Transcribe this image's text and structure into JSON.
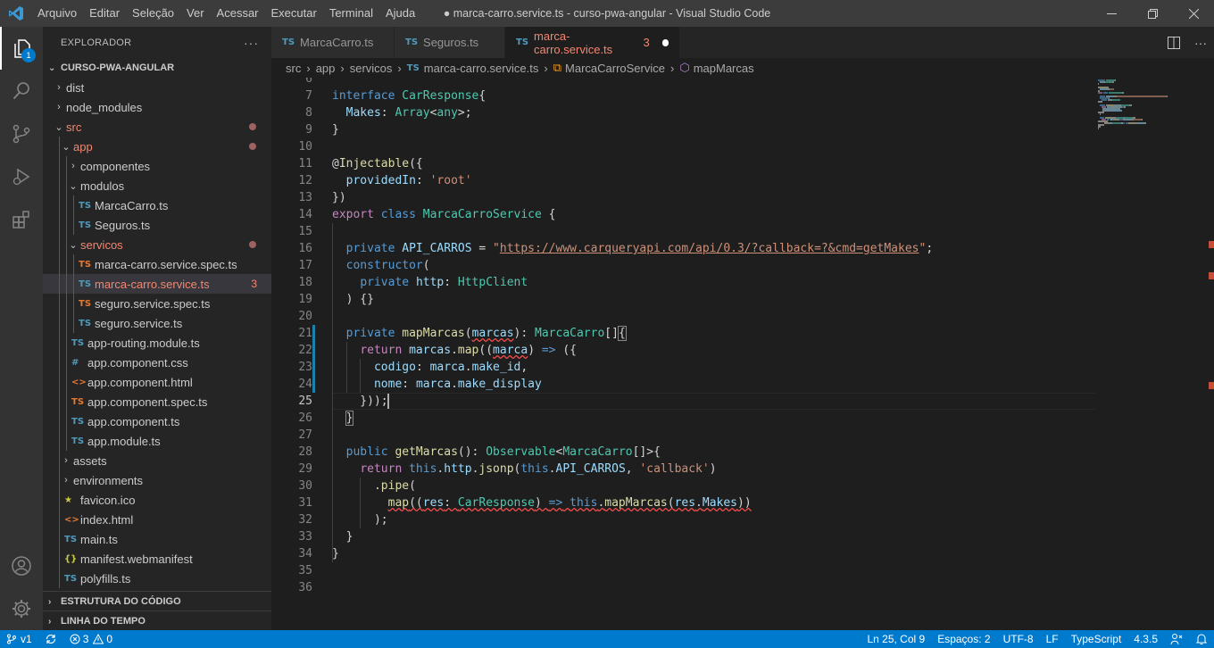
{
  "window": {
    "title": "● marca-carro.service.ts - curso-pwa-angular - Visual Studio Code",
    "menu": [
      "Arquivo",
      "Editar",
      "Seleção",
      "Ver",
      "Acessar",
      "Executar",
      "Terminal",
      "Ajuda"
    ]
  },
  "activity_bar": {
    "explorer_badge": "1",
    "items": [
      "explorer-icon",
      "search-icon",
      "source-control-icon",
      "run-debug-icon",
      "extensions-icon",
      "account-icon",
      "gear-icon"
    ]
  },
  "sidebar": {
    "header": "EXPLORADOR",
    "more": "···",
    "project": "CURSO-PWA-ANGULAR",
    "tree": [
      {
        "label": "dist",
        "type": "folder",
        "open": false,
        "depth": 1
      },
      {
        "label": "node_modules",
        "type": "folder",
        "open": false,
        "depth": 1
      },
      {
        "label": "src",
        "type": "folder",
        "open": true,
        "depth": 1,
        "modified": true
      },
      {
        "label": "app",
        "type": "folder",
        "open": true,
        "depth": 2,
        "modified": true
      },
      {
        "label": "componentes",
        "type": "folder",
        "open": false,
        "depth": 3
      },
      {
        "label": "modulos",
        "type": "folder",
        "open": true,
        "depth": 3
      },
      {
        "label": "MarcaCarro.ts",
        "type": "ts",
        "depth": 4
      },
      {
        "label": "Seguros.ts",
        "type": "ts",
        "depth": 4
      },
      {
        "label": "servicos",
        "type": "folder",
        "open": true,
        "depth": 3,
        "modified": true
      },
      {
        "label": "marca-carro.service.spec.ts",
        "type": "ts-spec",
        "depth": 4
      },
      {
        "label": "marca-carro.service.ts",
        "type": "ts",
        "depth": 4,
        "selected": true,
        "errors": "3"
      },
      {
        "label": "seguro.service.spec.ts",
        "type": "ts-spec",
        "depth": 4
      },
      {
        "label": "seguro.service.ts",
        "type": "ts",
        "depth": 4
      },
      {
        "label": "app-routing.module.ts",
        "type": "ts",
        "depth": 3
      },
      {
        "label": "app.component.css",
        "type": "css",
        "depth": 3
      },
      {
        "label": "app.component.html",
        "type": "html",
        "depth": 3
      },
      {
        "label": "app.component.spec.ts",
        "type": "ts-spec",
        "depth": 3
      },
      {
        "label": "app.component.ts",
        "type": "ts",
        "depth": 3
      },
      {
        "label": "app.module.ts",
        "type": "ts",
        "depth": 3
      },
      {
        "label": "assets",
        "type": "folder",
        "open": false,
        "depth": 2
      },
      {
        "label": "environments",
        "type": "folder",
        "open": false,
        "depth": 2
      },
      {
        "label": "favicon.ico",
        "type": "ico",
        "depth": 2
      },
      {
        "label": "index.html",
        "type": "html",
        "depth": 2
      },
      {
        "label": "main.ts",
        "type": "ts",
        "depth": 2
      },
      {
        "label": "manifest.webmanifest",
        "type": "json",
        "depth": 2
      },
      {
        "label": "polyfills.ts",
        "type": "ts",
        "depth": 2
      }
    ],
    "outline_label": "ESTRUTURA DO CÓDIGO",
    "timeline_label": "LINHA DO TEMPO"
  },
  "tabs": [
    {
      "label": "MarcaCarro.ts",
      "active": false
    },
    {
      "label": "Seguros.ts",
      "active": false
    },
    {
      "label": "marca-carro.service.ts",
      "active": true,
      "problems": "3",
      "dirty": true
    }
  ],
  "breadcrumb": [
    "src",
    "app",
    "servicos",
    "marca-carro.service.ts",
    "MarcaCarroService",
    "mapMarcas"
  ],
  "editor": {
    "cursor_line": 25,
    "line_numbers": [
      "6",
      "7",
      "8",
      "9",
      "10",
      "11",
      "12",
      "13",
      "14",
      "15",
      "16",
      "17",
      "18",
      "19",
      "20",
      "21",
      "22",
      "23",
      "24",
      "25",
      "26",
      "27",
      "28",
      "29",
      "30",
      "31",
      "32",
      "33",
      "34",
      "35",
      "36"
    ],
    "lines": [
      [],
      [
        [
          "k",
          "interface"
        ],
        [
          "p",
          " "
        ],
        [
          "t",
          "CarResponse"
        ],
        [
          "p",
          "{"
        ]
      ],
      [
        [
          "p",
          "  "
        ],
        [
          "v",
          "Makes"
        ],
        [
          "p",
          ": "
        ],
        [
          "t",
          "Array"
        ],
        [
          "p",
          "<"
        ],
        [
          "t",
          "any"
        ],
        [
          "p",
          ">;"
        ]
      ],
      [
        [
          "p",
          "}"
        ]
      ],
      [],
      [
        [
          "p",
          "@"
        ],
        [
          "f",
          "Injectable"
        ],
        [
          "p",
          "({"
        ]
      ],
      [
        [
          "p",
          "  "
        ],
        [
          "v",
          "providedIn"
        ],
        [
          "p",
          ": "
        ],
        [
          "s",
          "'root'"
        ]
      ],
      [
        [
          "p",
          "})"
        ]
      ],
      [
        [
          "kc",
          "export"
        ],
        [
          "p",
          " "
        ],
        [
          "k",
          "class"
        ],
        [
          "p",
          " "
        ],
        [
          "t",
          "MarcaCarroService"
        ],
        [
          "p",
          " {"
        ]
      ],
      [],
      [
        [
          "p",
          "  "
        ],
        [
          "k",
          "private"
        ],
        [
          "p",
          " "
        ],
        [
          "v",
          "API_CARROS"
        ],
        [
          "p",
          " = "
        ],
        [
          "s",
          "\""
        ],
        [
          "su",
          "https://www.carqueryapi.com/api/0.3/?callback=?&cmd=getMakes"
        ],
        [
          "s",
          "\""
        ],
        [
          "p",
          ";"
        ]
      ],
      [
        [
          "p",
          "  "
        ],
        [
          "k",
          "constructor"
        ],
        [
          "p",
          "("
        ]
      ],
      [
        [
          "p",
          "    "
        ],
        [
          "k",
          "private"
        ],
        [
          "p",
          " "
        ],
        [
          "v",
          "http"
        ],
        [
          "p",
          ": "
        ],
        [
          "t",
          "HttpClient"
        ]
      ],
      [
        [
          "p",
          "  ) {}"
        ]
      ],
      [],
      [
        [
          "p",
          "  "
        ],
        [
          "k",
          "private"
        ],
        [
          "p",
          " "
        ],
        [
          "f",
          "mapMarcas"
        ],
        [
          "p",
          "("
        ],
        [
          "verr",
          "marcas"
        ],
        [
          "p",
          "): "
        ],
        [
          "t",
          "MarcaCarro"
        ],
        [
          "p",
          "[]"
        ],
        [
          "pb",
          "{"
        ]
      ],
      [
        [
          "p",
          "    "
        ],
        [
          "kc",
          "return"
        ],
        [
          "p",
          " "
        ],
        [
          "v",
          "marcas"
        ],
        [
          "p",
          "."
        ],
        [
          "f",
          "map"
        ],
        [
          "p",
          "(("
        ],
        [
          "verr",
          "marca"
        ],
        [
          "p",
          ") "
        ],
        [
          "k",
          "=>"
        ],
        [
          "p",
          " ({"
        ]
      ],
      [
        [
          "p",
          "      "
        ],
        [
          "v",
          "codigo"
        ],
        [
          "p",
          ": "
        ],
        [
          "v",
          "marca"
        ],
        [
          "p",
          "."
        ],
        [
          "v",
          "make_id"
        ],
        [
          "p",
          ","
        ]
      ],
      [
        [
          "p",
          "      "
        ],
        [
          "v",
          "nome"
        ],
        [
          "p",
          ": "
        ],
        [
          "v",
          "marca"
        ],
        [
          "p",
          "."
        ],
        [
          "v",
          "make_display"
        ]
      ],
      [
        [
          "p",
          "    }));"
        ],
        [
          "cursor",
          ""
        ]
      ],
      [
        [
          "p",
          "  "
        ],
        [
          "pb",
          "}"
        ]
      ],
      [],
      [
        [
          "p",
          "  "
        ],
        [
          "k",
          "public"
        ],
        [
          "p",
          " "
        ],
        [
          "f",
          "getMarcas"
        ],
        [
          "p",
          "(): "
        ],
        [
          "t",
          "Observable"
        ],
        [
          "p",
          "<"
        ],
        [
          "t",
          "MarcaCarro"
        ],
        [
          "p",
          "[]>{"
        ]
      ],
      [
        [
          "p",
          "    "
        ],
        [
          "kc",
          "return"
        ],
        [
          "p",
          " "
        ],
        [
          "k",
          "this"
        ],
        [
          "p",
          "."
        ],
        [
          "v",
          "http"
        ],
        [
          "p",
          "."
        ],
        [
          "f",
          "jsonp"
        ],
        [
          "p",
          "("
        ],
        [
          "k",
          "this"
        ],
        [
          "p",
          "."
        ],
        [
          "v",
          "API_CARROS"
        ],
        [
          "p",
          ", "
        ],
        [
          "s",
          "'callback'"
        ],
        [
          "p",
          ")"
        ]
      ],
      [
        [
          "p",
          "      ."
        ],
        [
          "f",
          "pipe"
        ],
        [
          "p",
          "("
        ]
      ],
      [
        [
          "p",
          "        "
        ],
        [
          "ferr",
          "map"
        ],
        [
          "perr",
          "(("
        ],
        [
          "verr",
          "res"
        ],
        [
          "perr",
          ": "
        ],
        [
          "terr",
          "CarResponse"
        ],
        [
          "perr",
          ") "
        ],
        [
          "kerr",
          "=>"
        ],
        [
          "perr",
          " "
        ],
        [
          "kerr",
          "this"
        ],
        [
          "perr",
          "."
        ],
        [
          "ferr",
          "mapMarcas"
        ],
        [
          "perr",
          "("
        ],
        [
          "verr",
          "res"
        ],
        [
          "perr",
          "."
        ],
        [
          "verr",
          "Makes"
        ],
        [
          "perr",
          "))"
        ]
      ],
      [
        [
          "p",
          "      );"
        ]
      ],
      [
        [
          "p",
          "  }"
        ]
      ],
      [
        [
          "p",
          "}"
        ]
      ],
      [],
      []
    ]
  },
  "status_bar": {
    "branch": "v1",
    "errors": "3",
    "warnings": "0",
    "position": "Ln 25, Col 9",
    "spaces": "Espaços: 2",
    "encoding": "UTF-8",
    "eol": "LF",
    "language": "TypeScript",
    "ts_version": "4.3.5"
  },
  "colors": {
    "accent": "#007acc",
    "error": "#f48771",
    "activity_bar": "#333333",
    "sidebar": "#252526",
    "editor": "#1e1e1e"
  }
}
